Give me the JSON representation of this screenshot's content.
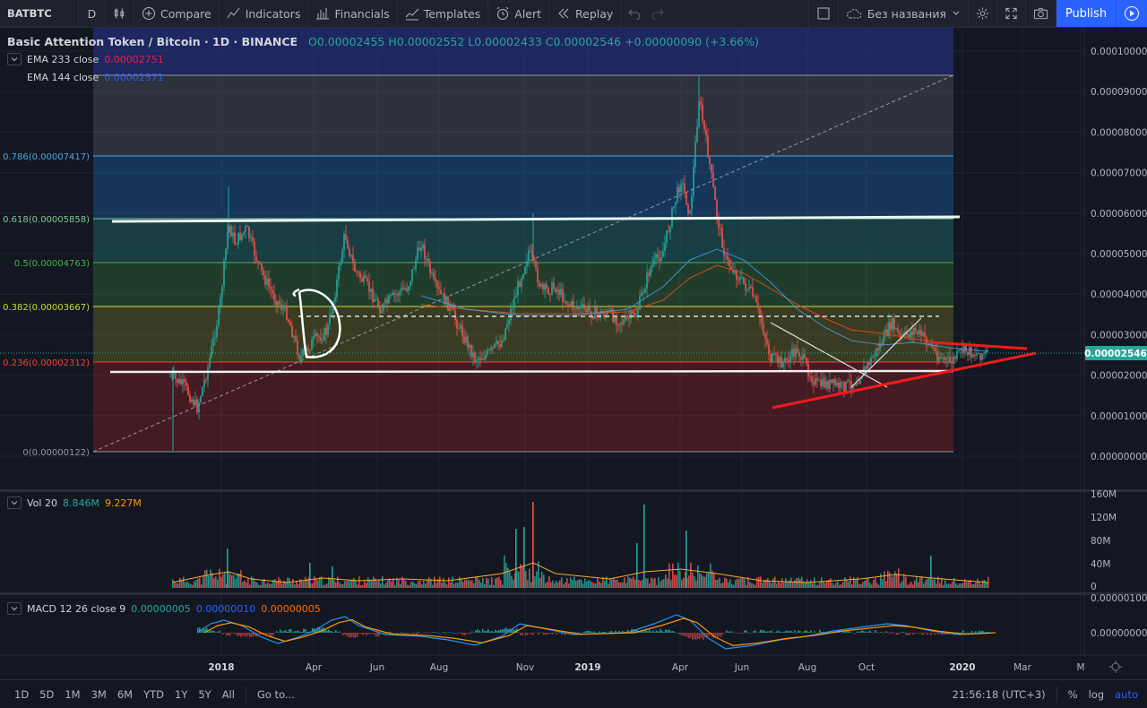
{
  "toolbar": {
    "symbol": "BATBTC",
    "interval": "D",
    "compare": "Compare",
    "indicators": "Indicators",
    "financials": "Financials",
    "templates": "Templates",
    "alert": "Alert",
    "replay": "Replay",
    "layout_name": "Без названия",
    "publish": "Publish"
  },
  "legend": {
    "title": "Basic Attention Token / Bitcoin · 1D · BINANCE",
    "o": "O0.00002455",
    "h": "H0.00002552",
    "l": "L0.00002433",
    "c": "C0.00002546",
    "change": "+0.00000090 (+3.66%)",
    "ema233_label": "EMA 233 close",
    "ema233_value": "0.00002751",
    "ema144_label": "EMA 144 close",
    "ema144_value": "0.00002571"
  },
  "volume": {
    "label": "Vol 20",
    "v1": "8.846M",
    "v2": "9.227M"
  },
  "macd": {
    "label": "MACD 12 26 close 9",
    "v1": "0.00000005",
    "v2": "0.00000010",
    "v3": "0.00000005"
  },
  "price_axis": [
    "0.00010000",
    "0.00009000",
    "0.00008000",
    "0.00007000",
    "0.00006000",
    "0.00005000",
    "0.00004000",
    "0.00003000",
    "0.00002000",
    "0.00001000",
    "0.00000000"
  ],
  "current_price": "0.00002546",
  "volume_axis": [
    "160M",
    "120M",
    "80M",
    "40M",
    "0"
  ],
  "macd_axis": [
    "0.00000100",
    "0.00000000"
  ],
  "time_axis": [
    "2018",
    "Apr",
    "Jun",
    "Aug",
    "Nov",
    "2019",
    "Apr",
    "Jun",
    "Aug",
    "Oct",
    "2020",
    "Mar",
    "M"
  ],
  "fib_levels": [
    {
      "label": "0.786(0.00007417)",
      "color": "#4fa3e0"
    },
    {
      "label": "0.618(0.00005858)",
      "color": "#81c995"
    },
    {
      "label": "0.5(0.00004763)",
      "color": "#4caf50"
    },
    {
      "label": "0.382(0.00003667)",
      "color": "#cddc39"
    },
    {
      "label": "0.236(0.00002312)",
      "color": "#f44336"
    },
    {
      "label": "0(0.00000122)",
      "color": "#9598a1"
    }
  ],
  "bottombar": {
    "ranges": [
      "1D",
      "5D",
      "1M",
      "3M",
      "6M",
      "YTD",
      "1Y",
      "5Y",
      "All"
    ],
    "goto": "Go to...",
    "clock": "21:56:18 (UTC+3)",
    "percent": "%",
    "log": "log",
    "auto": "auto"
  },
  "colors": {
    "up": "#26a69a",
    "down": "#ef5350",
    "accent": "#2962ff",
    "ema233": "#ff1744",
    "ema144": "#2962ff"
  }
}
